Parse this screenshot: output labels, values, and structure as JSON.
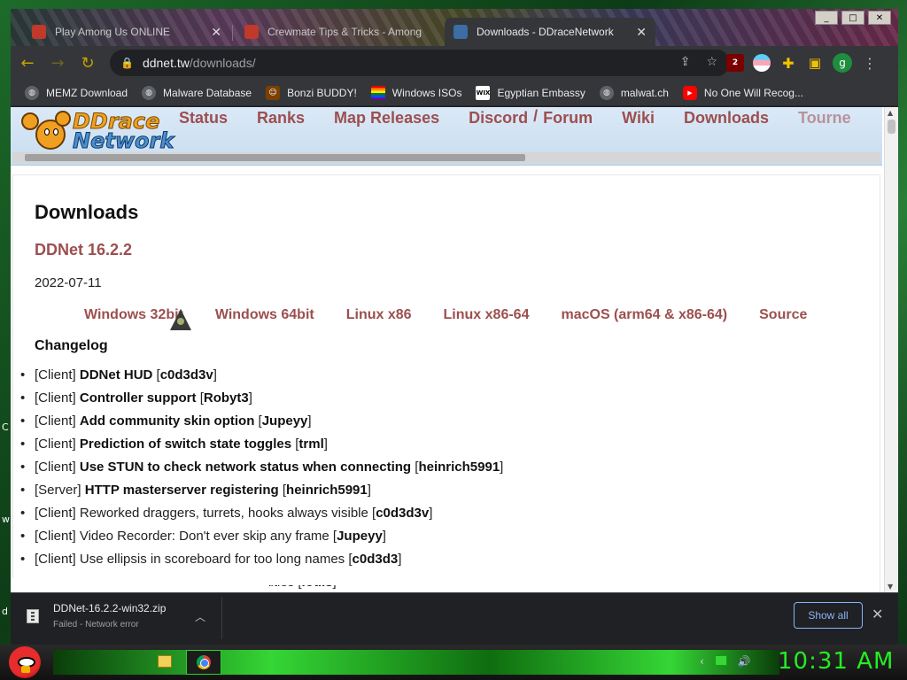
{
  "browser": {
    "tabs": [
      {
        "label": "Play Among Us ONLINE",
        "active": false
      },
      {
        "label": "Crewmate Tips & Tricks - Among",
        "active": false
      },
      {
        "label": "Downloads - DDraceNetwork",
        "active": true
      }
    ],
    "window_controls": {
      "minimize": "_",
      "maximize": "□",
      "close": "✕"
    },
    "url": {
      "host": "ddnet.tw",
      "path": "/downloads/"
    },
    "profile_initial": "g",
    "ublock_count": "2",
    "bookmarks": [
      {
        "label": "MEMZ Download",
        "icon": "globe-icon"
      },
      {
        "label": "Malware Database",
        "icon": "globe-icon"
      },
      {
        "label": "Bonzi BUDDY!",
        "icon": "bonzi-icon"
      },
      {
        "label": "Windows ISOs",
        "icon": "rainbow-flag-icon"
      },
      {
        "label": "Egyptian Embassy",
        "icon": "wix-icon"
      },
      {
        "label": "malwat.ch",
        "icon": "globe-icon"
      },
      {
        "label": "No One Will Recog...",
        "icon": "youtube-icon"
      }
    ]
  },
  "site": {
    "logo_line1": "DDrace",
    "logo_line2": "Network",
    "nav": [
      "Status",
      "Ranks",
      "Map Releases",
      "Discord",
      "Forum",
      "Wiki",
      "Downloads",
      "Tourne"
    ],
    "nav_separator": "/"
  },
  "page": {
    "title": "Downloads",
    "version": "DDNet 16.2.2",
    "date": "2022-07-11",
    "downloads": [
      "Windows 32bit",
      "Windows 64bit",
      "Linux x86",
      "Linux x86-64",
      "macOS (arm64 & x86-64)",
      "Source"
    ],
    "changelog_title": "Changelog",
    "changelog": [
      {
        "tag": "[Client]",
        "text": "DDNet HUD",
        "author": "c0d3d3v",
        "bold": true
      },
      {
        "tag": "[Client]",
        "text": "Controller support",
        "author": "Robyt3",
        "bold": true
      },
      {
        "tag": "[Client]",
        "text": "Add community skin option",
        "author": "Jupeyy",
        "bold": true
      },
      {
        "tag": "[Client]",
        "text": "Prediction of switch state toggles",
        "author": "trml",
        "bold": true
      },
      {
        "tag": "[Client]",
        "text": "Use STUN to check network status when connecting",
        "author": "heinrich5991",
        "bold": true
      },
      {
        "tag": "[Server]",
        "text": "HTTP masterserver registering",
        "author": "heinrich5991",
        "bold": true
      },
      {
        "tag": "[Client]",
        "text": "Reworked draggers, turrets, hooks always visible",
        "author": "c0d3d3v",
        "bold": false
      },
      {
        "tag": "[Client]",
        "text": "Video Recorder: Don't ever skip any frame",
        "author": "Jupeyy",
        "bold": false
      },
      {
        "tag": "[Client]",
        "text": "Use ellipsis in scoreboard for too long names",
        "author": "c0d3d3",
        "bold": false
      },
      {
        "tag": "",
        "text": "ntities",
        "author": "louis",
        "bold": false
      }
    ]
  },
  "download_shelf": {
    "file_name": "DDNet-16.2.2-win32.zip",
    "status": "Failed - Network error",
    "show_all": "Show all"
  },
  "taskbar": {
    "clock": "10:31 AM"
  },
  "desktop_letters": [
    "C",
    "w",
    "d"
  ]
}
